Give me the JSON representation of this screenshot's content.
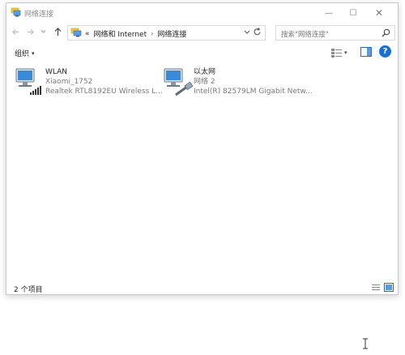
{
  "window": {
    "title": "网络连接",
    "controls": {
      "minimize": "—",
      "maximize": "☐",
      "close": "✕"
    }
  },
  "navigation": {
    "back_icon": "arrow-left-icon",
    "forward_icon": "arrow-right-icon",
    "recent_icon": "chevron-down-icon",
    "up_icon": "arrow-up-icon"
  },
  "address_bar": {
    "overflow": "«",
    "crumbs": [
      "网络和 Internet",
      "网络连接"
    ],
    "separator": "›",
    "dropdown_icon": "chevron-down-icon",
    "refresh_icon": "refresh-icon"
  },
  "search": {
    "placeholder": "搜索\"网络连接\""
  },
  "toolbar": {
    "organize_label": "组织",
    "organize_caret": "▾",
    "views_caret": "▾",
    "help_label": "?"
  },
  "connections": [
    {
      "name": "WLAN",
      "network": "Xiaomi_1752",
      "adapter": "Realtek RTL8192EU Wireless L...",
      "icon": "wireless-network-icon"
    },
    {
      "name": "以太网",
      "network": "网络 2",
      "adapter": "Intel(R) 82579LM Gigabit Netw...",
      "icon": "ethernet-network-icon"
    }
  ],
  "status_bar": {
    "item_count": "2 个项目"
  },
  "colors": {
    "accent": "#1a6fd1",
    "border": "#c9c9c9",
    "secondary_text": "#7a7a7a"
  }
}
